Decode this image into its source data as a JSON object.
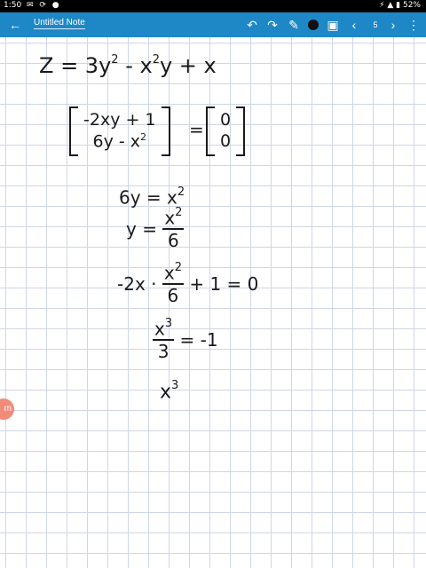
{
  "status_bar": {
    "time": "1:50",
    "left_icons": "✉ ⟳ ●",
    "battery": "52%",
    "signal": "⚡ ▲ ▮"
  },
  "app_bar": {
    "back_icon": "←",
    "title": "Untitled Note",
    "undo_icon": "↶",
    "redo_icon": "↷",
    "pen_icon": "✎",
    "eraser_icon": "⌫",
    "image_icon": "▣",
    "prev_icon": "‹",
    "page_number": "5",
    "next_icon": "›",
    "more_icon": "⋮",
    "accent_color": "#1e88c7"
  },
  "note": {
    "line1": {
      "a": "Z = 3y",
      "b": "2",
      "c": " - x",
      "d": "2",
      "e": "y + x"
    },
    "matrix_left": {
      "row1": "-2xy + 1",
      "row2a": "6y - x",
      "row2b": "2"
    },
    "matrix_right": {
      "row1": "0",
      "row2": "0"
    },
    "eq1": {
      "a": "6y = x",
      "b": "2"
    },
    "eq2": {
      "lhs": "y =",
      "num": "x",
      "num_sup": "2",
      "den": "6"
    },
    "eq3": {
      "lhs": "-2x · ",
      "num": "x",
      "num_sup": "2",
      "den": "6",
      "rhs": " + 1 = 0"
    },
    "eq4": {
      "num": "x",
      "num_sup": "3",
      "den": "3",
      "rhs": " = -1"
    },
    "eq5": {
      "a": "x",
      "b": "3"
    }
  },
  "side_bubble": {
    "label": "m"
  }
}
